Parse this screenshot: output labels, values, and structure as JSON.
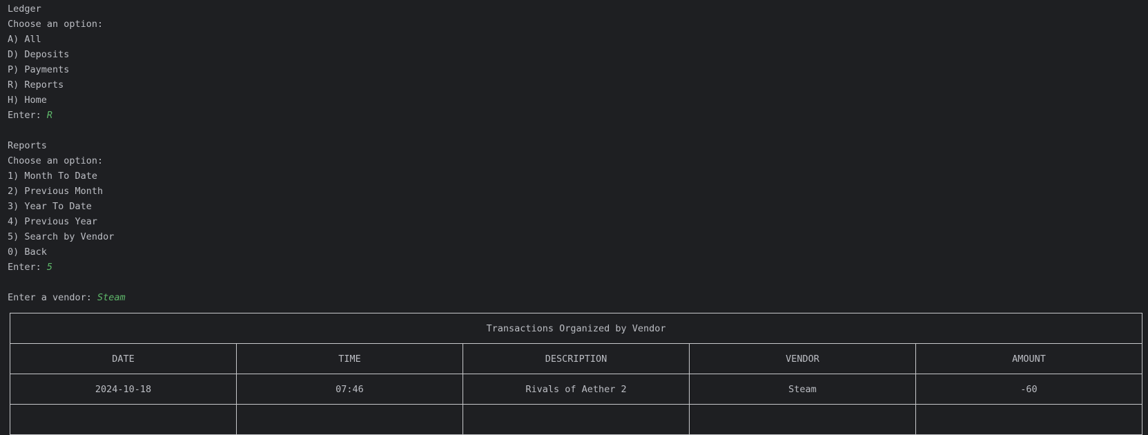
{
  "ledger_menu": {
    "title": "Ledger",
    "prompt": "Choose an option:",
    "options": [
      "A) All",
      "D) Deposits",
      "P) Payments",
      "R) Reports",
      "H) Home"
    ],
    "enter_label": "Enter: ",
    "enter_value": "R"
  },
  "reports_menu": {
    "title": "Reports",
    "prompt": "Choose an option:",
    "options": [
      "1) Month To Date",
      "2) Previous Month",
      "3) Year To Date",
      "4) Previous Year",
      "5) Search by Vendor",
      "0) Back"
    ],
    "enter_label": "Enter: ",
    "enter_value": "5"
  },
  "vendor_prompt": {
    "label": "Enter a vendor: ",
    "value": "Steam"
  },
  "table": {
    "title": "Transactions Organized by Vendor",
    "headers": [
      "DATE",
      "TIME",
      "DESCRIPTION",
      "VENDOR",
      "AMOUNT"
    ],
    "rows": [
      [
        "2024-10-18",
        "07:46",
        "Rivals of Aether 2",
        "Steam",
        "-60"
      ]
    ]
  },
  "colors": {
    "background": "#1e1f22",
    "text": "#bcbec4",
    "user_input": "#5fb96b"
  }
}
